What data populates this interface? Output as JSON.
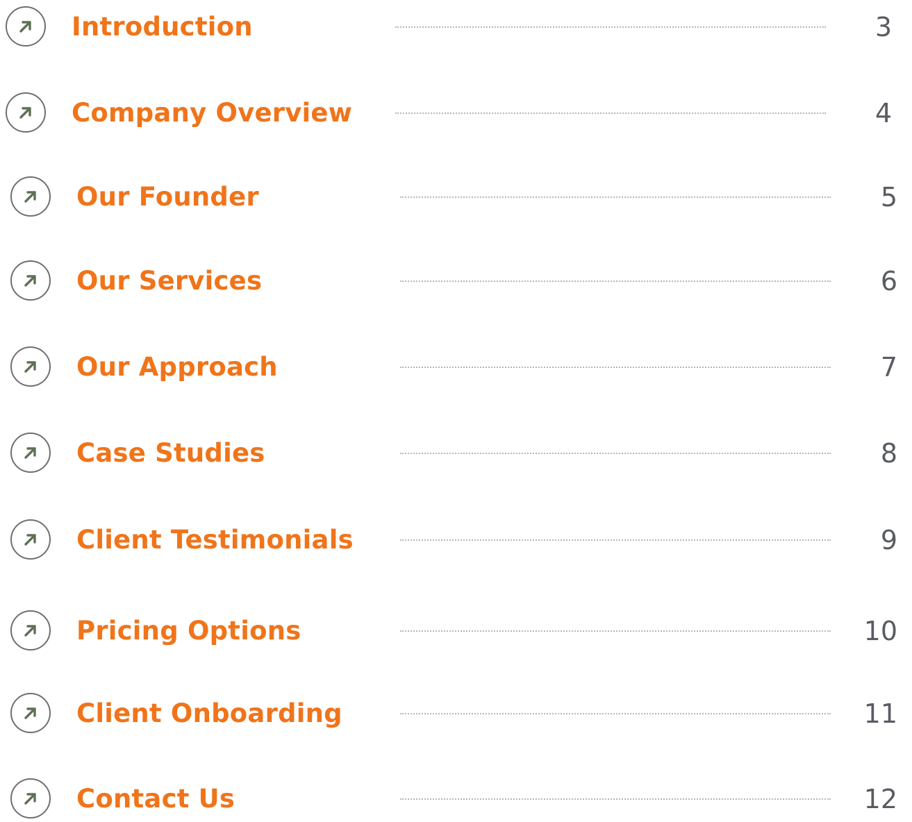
{
  "toc": {
    "icon": "arrow-up-right-icon",
    "colors": {
      "title": "#f0741a",
      "page_number": "#5a5c63",
      "icon_stroke": "#6f6f72",
      "icon_arrow": "#5e7056",
      "leader": "#b6b6b8"
    },
    "entries": [
      {
        "title": "Introduction",
        "page": "3"
      },
      {
        "title": "Company Overview",
        "page": "4"
      },
      {
        "title": "Our Founder",
        "page": "5"
      },
      {
        "title": "Our Services",
        "page": "6"
      },
      {
        "title": "Our Approach",
        "page": "7"
      },
      {
        "title": "Case Studies",
        "page": "8"
      },
      {
        "title": "Client Testimonials",
        "page": "9"
      },
      {
        "title": "Pricing Options",
        "page": "10"
      },
      {
        "title": "Client Onboarding",
        "page": "11"
      },
      {
        "title": "Contact Us",
        "page": "12"
      }
    ]
  }
}
